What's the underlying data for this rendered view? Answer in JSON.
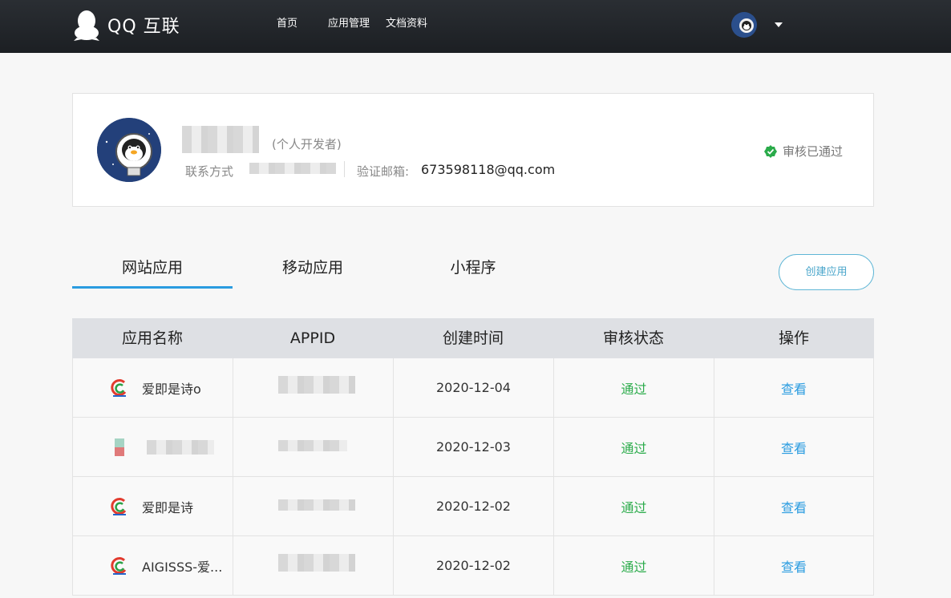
{
  "header": {
    "logo_text": "QQ 互联",
    "nav": [
      "首页",
      "应用管理",
      "文档资料"
    ]
  },
  "profile": {
    "dev_type": "(个人开发者)",
    "contact_label": "联系方式",
    "email_label": "验证邮箱:",
    "email_value": "673598118@qq.com",
    "status": "审核已通过"
  },
  "tabs": [
    "网站应用",
    "移动应用",
    "小程序"
  ],
  "active_tab": 0,
  "create_button": "创建应用",
  "table": {
    "headers": [
      "应用名称",
      "APPID",
      "创建时间",
      "审核状态",
      "操作"
    ],
    "rows": [
      {
        "name": "爱即是诗o",
        "date": "2020-12-04",
        "status": "通过",
        "action": "查看"
      },
      {
        "name": "",
        "date": "2020-12-03",
        "status": "通过",
        "action": "查看"
      },
      {
        "name": "爱即是诗",
        "date": "2020-12-02",
        "status": "通过",
        "action": "查看"
      },
      {
        "name": "AIGISSS-爱...",
        "date": "2020-12-02",
        "status": "通过",
        "action": "查看"
      }
    ]
  },
  "colors": {
    "accent": "#2a9ce0",
    "pass": "#2aab4a",
    "header_bg": "#1f2226"
  }
}
